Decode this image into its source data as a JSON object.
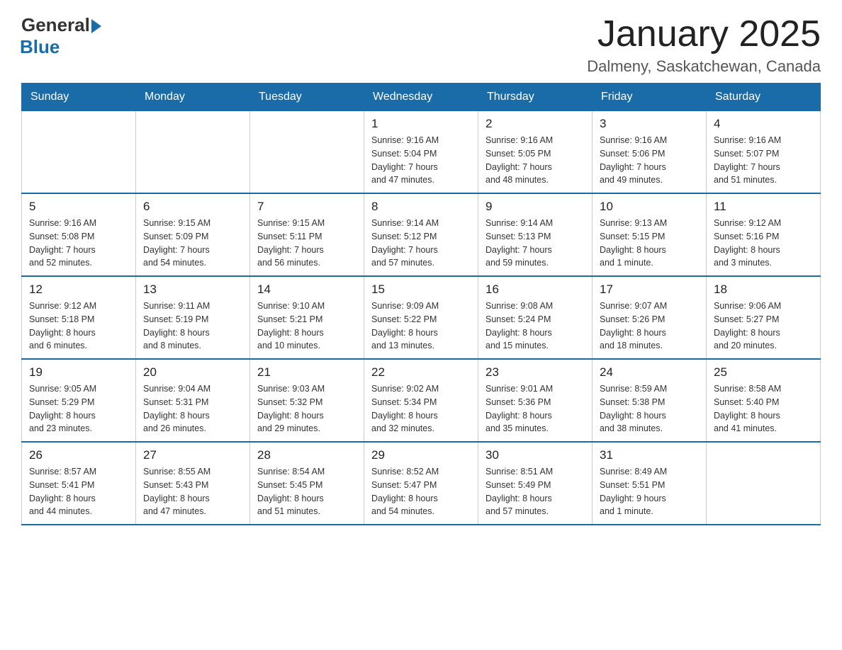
{
  "logo": {
    "general": "General",
    "blue": "Blue"
  },
  "title": "January 2025",
  "subtitle": "Dalmeny, Saskatchewan, Canada",
  "weekdays": [
    "Sunday",
    "Monday",
    "Tuesday",
    "Wednesday",
    "Thursday",
    "Friday",
    "Saturday"
  ],
  "weeks": [
    [
      {
        "day": "",
        "info": ""
      },
      {
        "day": "",
        "info": ""
      },
      {
        "day": "",
        "info": ""
      },
      {
        "day": "1",
        "info": "Sunrise: 9:16 AM\nSunset: 5:04 PM\nDaylight: 7 hours\nand 47 minutes."
      },
      {
        "day": "2",
        "info": "Sunrise: 9:16 AM\nSunset: 5:05 PM\nDaylight: 7 hours\nand 48 minutes."
      },
      {
        "day": "3",
        "info": "Sunrise: 9:16 AM\nSunset: 5:06 PM\nDaylight: 7 hours\nand 49 minutes."
      },
      {
        "day": "4",
        "info": "Sunrise: 9:16 AM\nSunset: 5:07 PM\nDaylight: 7 hours\nand 51 minutes."
      }
    ],
    [
      {
        "day": "5",
        "info": "Sunrise: 9:16 AM\nSunset: 5:08 PM\nDaylight: 7 hours\nand 52 minutes."
      },
      {
        "day": "6",
        "info": "Sunrise: 9:15 AM\nSunset: 5:09 PM\nDaylight: 7 hours\nand 54 minutes."
      },
      {
        "day": "7",
        "info": "Sunrise: 9:15 AM\nSunset: 5:11 PM\nDaylight: 7 hours\nand 56 minutes."
      },
      {
        "day": "8",
        "info": "Sunrise: 9:14 AM\nSunset: 5:12 PM\nDaylight: 7 hours\nand 57 minutes."
      },
      {
        "day": "9",
        "info": "Sunrise: 9:14 AM\nSunset: 5:13 PM\nDaylight: 7 hours\nand 59 minutes."
      },
      {
        "day": "10",
        "info": "Sunrise: 9:13 AM\nSunset: 5:15 PM\nDaylight: 8 hours\nand 1 minute."
      },
      {
        "day": "11",
        "info": "Sunrise: 9:12 AM\nSunset: 5:16 PM\nDaylight: 8 hours\nand 3 minutes."
      }
    ],
    [
      {
        "day": "12",
        "info": "Sunrise: 9:12 AM\nSunset: 5:18 PM\nDaylight: 8 hours\nand 6 minutes."
      },
      {
        "day": "13",
        "info": "Sunrise: 9:11 AM\nSunset: 5:19 PM\nDaylight: 8 hours\nand 8 minutes."
      },
      {
        "day": "14",
        "info": "Sunrise: 9:10 AM\nSunset: 5:21 PM\nDaylight: 8 hours\nand 10 minutes."
      },
      {
        "day": "15",
        "info": "Sunrise: 9:09 AM\nSunset: 5:22 PM\nDaylight: 8 hours\nand 13 minutes."
      },
      {
        "day": "16",
        "info": "Sunrise: 9:08 AM\nSunset: 5:24 PM\nDaylight: 8 hours\nand 15 minutes."
      },
      {
        "day": "17",
        "info": "Sunrise: 9:07 AM\nSunset: 5:26 PM\nDaylight: 8 hours\nand 18 minutes."
      },
      {
        "day": "18",
        "info": "Sunrise: 9:06 AM\nSunset: 5:27 PM\nDaylight: 8 hours\nand 20 minutes."
      }
    ],
    [
      {
        "day": "19",
        "info": "Sunrise: 9:05 AM\nSunset: 5:29 PM\nDaylight: 8 hours\nand 23 minutes."
      },
      {
        "day": "20",
        "info": "Sunrise: 9:04 AM\nSunset: 5:31 PM\nDaylight: 8 hours\nand 26 minutes."
      },
      {
        "day": "21",
        "info": "Sunrise: 9:03 AM\nSunset: 5:32 PM\nDaylight: 8 hours\nand 29 minutes."
      },
      {
        "day": "22",
        "info": "Sunrise: 9:02 AM\nSunset: 5:34 PM\nDaylight: 8 hours\nand 32 minutes."
      },
      {
        "day": "23",
        "info": "Sunrise: 9:01 AM\nSunset: 5:36 PM\nDaylight: 8 hours\nand 35 minutes."
      },
      {
        "day": "24",
        "info": "Sunrise: 8:59 AM\nSunset: 5:38 PM\nDaylight: 8 hours\nand 38 minutes."
      },
      {
        "day": "25",
        "info": "Sunrise: 8:58 AM\nSunset: 5:40 PM\nDaylight: 8 hours\nand 41 minutes."
      }
    ],
    [
      {
        "day": "26",
        "info": "Sunrise: 8:57 AM\nSunset: 5:41 PM\nDaylight: 8 hours\nand 44 minutes."
      },
      {
        "day": "27",
        "info": "Sunrise: 8:55 AM\nSunset: 5:43 PM\nDaylight: 8 hours\nand 47 minutes."
      },
      {
        "day": "28",
        "info": "Sunrise: 8:54 AM\nSunset: 5:45 PM\nDaylight: 8 hours\nand 51 minutes."
      },
      {
        "day": "29",
        "info": "Sunrise: 8:52 AM\nSunset: 5:47 PM\nDaylight: 8 hours\nand 54 minutes."
      },
      {
        "day": "30",
        "info": "Sunrise: 8:51 AM\nSunset: 5:49 PM\nDaylight: 8 hours\nand 57 minutes."
      },
      {
        "day": "31",
        "info": "Sunrise: 8:49 AM\nSunset: 5:51 PM\nDaylight: 9 hours\nand 1 minute."
      },
      {
        "day": "",
        "info": ""
      }
    ]
  ]
}
